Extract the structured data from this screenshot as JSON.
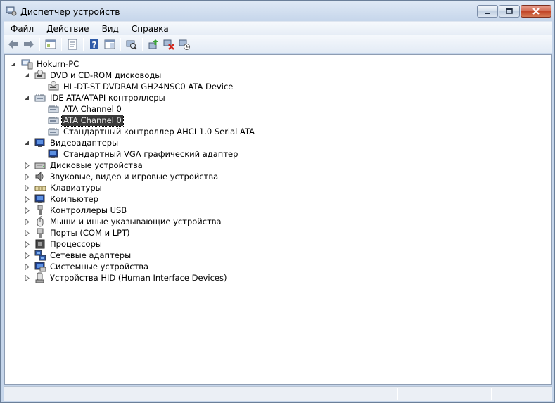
{
  "window": {
    "title": "Диспетчер устройств"
  },
  "menu": [
    "Файл",
    "Действие",
    "Вид",
    "Справка"
  ],
  "toolbar": {
    "buttons": [
      "back-arrow-icon",
      "forward-arrow-icon",
      "show-hide-console-tree-icon",
      "properties-icon",
      "help-icon",
      "show-action-pane-icon",
      "scan-hardware-icon",
      "update-driver-icon",
      "disable-device-icon",
      "uninstall-device-icon"
    ]
  },
  "tree": {
    "root": "Hokurn-PC",
    "categories": [
      {
        "label": "DVD и CD-ROM дисководы",
        "expanded": true,
        "icon": "dvd-drive-icon",
        "children": [
          "HL-DT-ST DVDRAM GH24NSC0 ATA Device"
        ]
      },
      {
        "label": "IDE ATA/ATAPI контроллеры",
        "expanded": true,
        "icon": "ide-controller-icon",
        "children": [
          "ATA Channel 0",
          "ATA Channel 0",
          "Стандартный контроллер AHCI 1.0 Serial ATA"
        ]
      },
      {
        "label": "Видеоадаптеры",
        "expanded": true,
        "icon": "display-adapter-icon",
        "children": [
          "Стандартный VGA графический адаптер"
        ]
      },
      {
        "label": "Дисковые устройства",
        "expanded": false,
        "icon": "disk-drive-icon",
        "children": []
      },
      {
        "label": "Звуковые, видео и игровые устройства",
        "expanded": false,
        "icon": "sound-device-icon",
        "children": []
      },
      {
        "label": "Клавиатуры",
        "expanded": false,
        "icon": "keyboard-icon",
        "children": []
      },
      {
        "label": "Компьютер",
        "expanded": false,
        "icon": "computer-icon",
        "children": []
      },
      {
        "label": "Контроллеры USB",
        "expanded": false,
        "icon": "usb-controller-icon",
        "children": []
      },
      {
        "label": "Мыши и иные указывающие устройства",
        "expanded": false,
        "icon": "mouse-icon",
        "children": []
      },
      {
        "label": "Порты (COM и LPT)",
        "expanded": false,
        "icon": "port-icon",
        "children": []
      },
      {
        "label": "Процессоры",
        "expanded": false,
        "icon": "processor-icon",
        "children": []
      },
      {
        "label": "Сетевые адаптеры",
        "expanded": false,
        "icon": "network-adapter-icon",
        "children": []
      },
      {
        "label": "Системные устройства",
        "expanded": false,
        "icon": "system-device-icon",
        "children": []
      },
      {
        "label": "Устройства HID (Human Interface Devices)",
        "expanded": false,
        "icon": "hid-device-icon",
        "children": []
      }
    ],
    "selected": "IDE ATA/ATAPI контроллеры / ATA Channel 0 (второй)"
  },
  "colors": {
    "selection_bg": "#3a3a3a",
    "close_button": "#c7452a",
    "tree_bg": "#ffffff"
  }
}
